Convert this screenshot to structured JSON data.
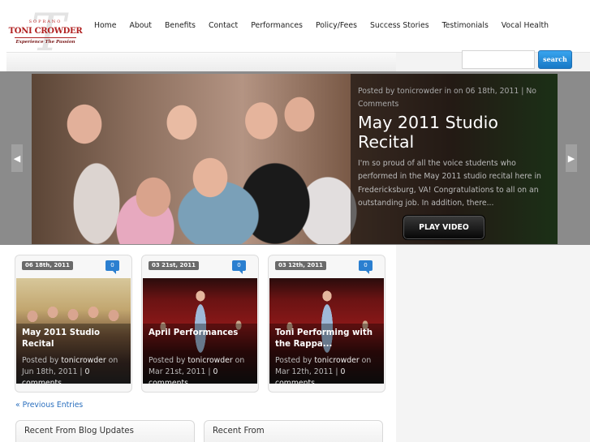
{
  "logo": {
    "top": "SOPRANO",
    "name": "TONI CROWDER",
    "tagline": "Experience The Passion"
  },
  "nav": [
    "Home",
    "About",
    "Benefits",
    "Contact",
    "Performances",
    "Policy/Fees",
    "Success Stories",
    "Testimonials",
    "Vocal Health"
  ],
  "search": {
    "placeholder": "",
    "button": "search"
  },
  "featured": {
    "meta": "Posted by tonicrowder in on 06 18th, 2011 | No Comments",
    "title": "May 2011 Studio Recital",
    "excerpt": "I'm so proud of all the voice students who performed in the May 2011 studio recital here in Fredericksburg, VA! Congratulations to all on an outstanding job. In addition, there...",
    "play_label": "PLAY VIDEO",
    "prev_arrow": "◀",
    "next_arrow": "▶"
  },
  "posts": [
    {
      "date": "06 18th, 2011",
      "comments": "0",
      "title": "May 2011 Studio Recital",
      "posted_by": "Posted by",
      "author": "tonicrowder",
      "on": "on",
      "posted_date": "Jun 18th, 2011",
      "comment_text": "0 comments"
    },
    {
      "date": "03 21st, 2011",
      "comments": "0",
      "title": "April Performances",
      "posted_by": "Posted by",
      "author": "tonicrowder",
      "on": "on",
      "posted_date": "Mar 21st, 2011",
      "comment_text": "0 comments"
    },
    {
      "date": "03 12th, 2011",
      "comments": "0",
      "title": "Toni Performing with the Rappa...",
      "posted_by": "Posted by",
      "author": "tonicrowder",
      "on": "on",
      "posted_date": "Mar 12th, 2011",
      "comment_text": "0 comments"
    }
  ],
  "previous_entries": "« Previous Entries",
  "widgets": [
    "Recent From Blog Updates",
    "Recent From"
  ],
  "colors": {
    "link": "#2a6fbe",
    "search_button": "#1779c6",
    "comment_badge": "#2b7fd0",
    "logo_red": "#b02020"
  }
}
